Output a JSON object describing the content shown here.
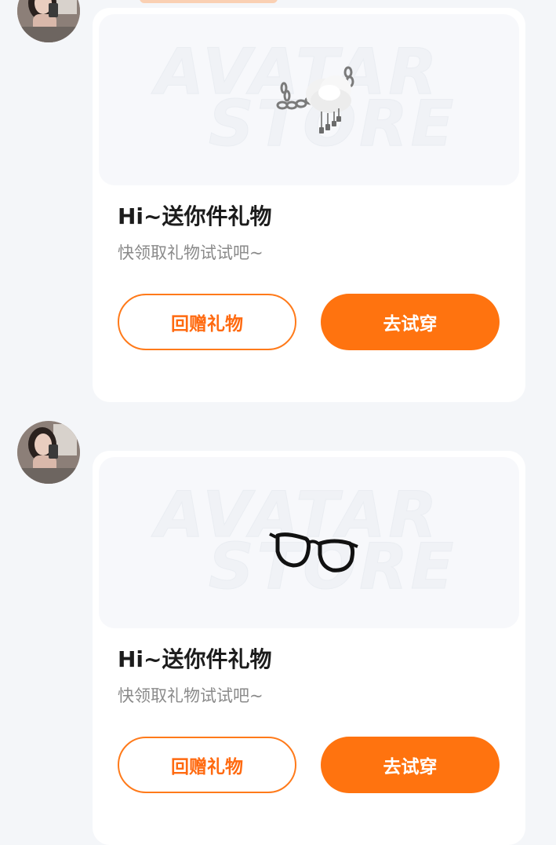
{
  "messages": [
    {
      "avatar": "user-photo-avatar",
      "item_icon": "chain-cloud-accessory-icon",
      "watermark_line1": "AVATAR",
      "watermark_line2": "STORE",
      "title": "Hi~送你件礼物",
      "subtitle": "快领取礼物试试吧~",
      "return_gift_label": "回赠礼物",
      "try_on_label": "去试穿"
    },
    {
      "avatar": "user-photo-avatar",
      "item_icon": "black-glasses-icon",
      "watermark_line1": "AVATAR",
      "watermark_line2": "STORE",
      "title": "Hi~送你件礼物",
      "subtitle": "快领取礼物试试吧~",
      "return_gift_label": "回赠礼物",
      "try_on_label": "去试穿"
    }
  ],
  "colors": {
    "accent": "#ff730f",
    "page_bg": "#f4f6f9",
    "card_bg": "#ffffff",
    "title": "#1c1c1c",
    "subtitle": "#8a8a8a"
  }
}
